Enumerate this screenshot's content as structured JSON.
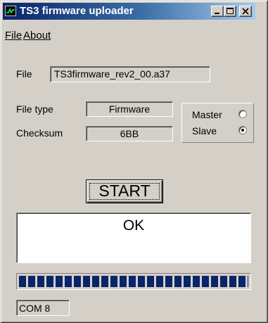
{
  "window": {
    "title": "TS3 firmware uploader",
    "icon": "waveform-icon",
    "controls": [
      "minimize-icon",
      "maximize-icon",
      "close-icon"
    ]
  },
  "menu": {
    "file": "File",
    "about": "About"
  },
  "file": {
    "label": "File",
    "value": "TS3firmware_rev2_00.a37"
  },
  "file_type": {
    "label": "File type",
    "value": "Firmware"
  },
  "checksum": {
    "label": "Checksum",
    "value": "6BB"
  },
  "mode": {
    "options": [
      {
        "label": "Master",
        "selected": false
      },
      {
        "label": "Slave",
        "selected": true
      }
    ]
  },
  "start_button": {
    "label": "START"
  },
  "output": {
    "text": "OK"
  },
  "progress": {
    "fraction": 1.0
  },
  "status": {
    "port": "COM 8"
  },
  "colors": {
    "title_start": "#0a246a",
    "title_end": "#a6caf0",
    "progress": "#0a246a",
    "face": "#d4d0c8"
  }
}
